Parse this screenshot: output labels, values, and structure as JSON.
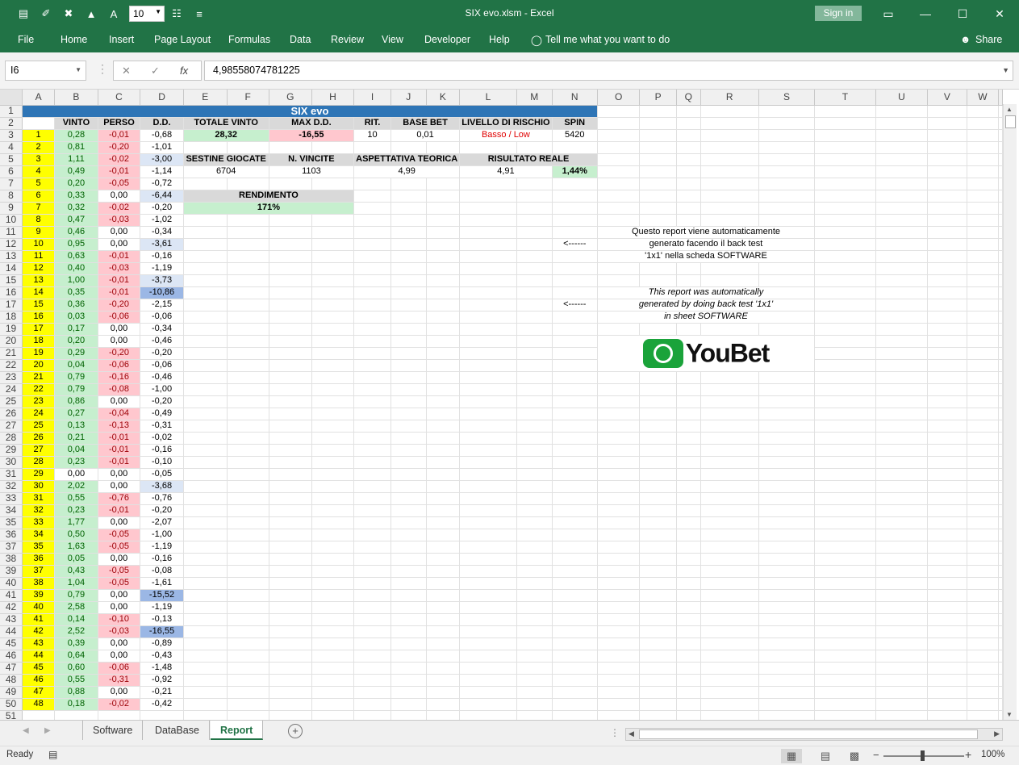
{
  "window": {
    "title": "SIX evo.xlsm  -  Excel",
    "sign_in": "Sign in",
    "font_size": "10"
  },
  "menu": {
    "items": [
      "File",
      "Home",
      "Insert",
      "Page Layout",
      "Formulas",
      "Data",
      "Review",
      "View",
      "Developer",
      "Help"
    ],
    "tell_me": "Tell me what you want to do",
    "share": "Share"
  },
  "formula_bar": {
    "name_box": "I6",
    "formula": "4,98558074781225"
  },
  "columns": [
    "A",
    "B",
    "C",
    "D",
    "E",
    "F",
    "G",
    "H",
    "I",
    "J",
    "K",
    "L",
    "M",
    "N",
    "O",
    "P",
    "Q",
    "R",
    "S",
    "T",
    "U",
    "V",
    "W"
  ],
  "report": {
    "banner": "SIX evo",
    "col_headers": [
      "VINTO",
      "PERSO",
      "D.D."
    ],
    "totale_vinto_label": "TOTALE VINTO",
    "totale_vinto": "28,32",
    "max_dd_label": "MAX D.D.",
    "max_dd": "-16,55",
    "rit_label": "RIT.",
    "rit": "10",
    "base_bet_label": "BASE BET",
    "base_bet": "0,01",
    "livello_label": "LIVELLO DI RISCHIO",
    "livello": "Basso / Low",
    "spin_label": "SPIN",
    "spin": "5420",
    "sestine_label": "SESTINE GIOCATE",
    "sestine": "6704",
    "vincite_label": "N. VINCITE",
    "vincite": "1103",
    "aspettativa_label": "ASPETTATIVA TEORICA",
    "aspettativa": "4,99",
    "risultato_label": "RISULTATO REALE",
    "risultato": "4,91",
    "risultato_pct": "1,44%",
    "rendimento_label": "RENDIMENTO",
    "rendimento": "171%",
    "note_it_arrow": "<------",
    "note_it": [
      "Questo report viene automaticamente",
      "generato facendo il back test",
      "'1x1' nella scheda SOFTWARE"
    ],
    "note_en_arrow": "<------",
    "note_en": [
      "This report was automatically",
      "generated by doing back test '1x1'",
      "in sheet SOFTWARE"
    ],
    "logo_text": "YouBet"
  },
  "rows": [
    [
      "1",
      "0,28",
      "-0,01",
      "-0,68"
    ],
    [
      "2",
      "0,81",
      "-0,20",
      "-1,01"
    ],
    [
      "3",
      "1,11",
      "-0,02",
      "-3,00"
    ],
    [
      "4",
      "0,49",
      "-0,01",
      "-1,14"
    ],
    [
      "5",
      "0,20",
      "-0,05",
      "-0,72"
    ],
    [
      "6",
      "0,33",
      "0,00",
      "-6,44"
    ],
    [
      "7",
      "0,32",
      "-0,02",
      "-0,20"
    ],
    [
      "8",
      "0,47",
      "-0,03",
      "-1,02"
    ],
    [
      "9",
      "0,46",
      "0,00",
      "-0,34"
    ],
    [
      "10",
      "0,95",
      "0,00",
      "-3,61"
    ],
    [
      "11",
      "0,63",
      "-0,01",
      "-0,16"
    ],
    [
      "12",
      "0,40",
      "-0,03",
      "-1,19"
    ],
    [
      "13",
      "1,00",
      "-0,01",
      "-3,73"
    ],
    [
      "14",
      "0,35",
      "-0,01",
      "-10,86"
    ],
    [
      "15",
      "0,36",
      "-0,20",
      "-2,15"
    ],
    [
      "16",
      "0,03",
      "-0,06",
      "-0,06"
    ],
    [
      "17",
      "0,17",
      "0,00",
      "-0,34"
    ],
    [
      "18",
      "0,20",
      "0,00",
      "-0,46"
    ],
    [
      "19",
      "0,29",
      "-0,20",
      "-0,20"
    ],
    [
      "20",
      "0,04",
      "-0,06",
      "-0,06"
    ],
    [
      "21",
      "0,79",
      "-0,16",
      "-0,46"
    ],
    [
      "22",
      "0,79",
      "-0,08",
      "-1,00"
    ],
    [
      "23",
      "0,86",
      "0,00",
      "-0,20"
    ],
    [
      "24",
      "0,27",
      "-0,04",
      "-0,49"
    ],
    [
      "25",
      "0,13",
      "-0,13",
      "-0,31"
    ],
    [
      "26",
      "0,21",
      "-0,01",
      "-0,02"
    ],
    [
      "27",
      "0,04",
      "-0,01",
      "-0,16"
    ],
    [
      "28",
      "0,23",
      "-0,01",
      "-0,10"
    ],
    [
      "29",
      "0,00",
      "0,00",
      "-0,05"
    ],
    [
      "30",
      "2,02",
      "0,00",
      "-3,68"
    ],
    [
      "31",
      "0,55",
      "-0,76",
      "-0,76"
    ],
    [
      "32",
      "0,23",
      "-0,01",
      "-0,20"
    ],
    [
      "33",
      "1,77",
      "0,00",
      "-2,07"
    ],
    [
      "34",
      "0,50",
      "-0,05",
      "-1,00"
    ],
    [
      "35",
      "1,63",
      "-0,05",
      "-1,19"
    ],
    [
      "36",
      "0,05",
      "0,00",
      "-0,16"
    ],
    [
      "37",
      "0,43",
      "-0,05",
      "-0,08"
    ],
    [
      "38",
      "1,04",
      "-0,05",
      "-1,61"
    ],
    [
      "39",
      "0,79",
      "0,00",
      "-15,52"
    ],
    [
      "40",
      "2,58",
      "0,00",
      "-1,19"
    ],
    [
      "41",
      "0,14",
      "-0,10",
      "-0,13"
    ],
    [
      "42",
      "2,52",
      "-0,03",
      "-16,55"
    ],
    [
      "43",
      "0,39",
      "0,00",
      "-0,89"
    ],
    [
      "44",
      "0,64",
      "0,00",
      "-0,43"
    ],
    [
      "45",
      "0,60",
      "-0,06",
      "-1,48"
    ],
    [
      "46",
      "0,55",
      "-0,31",
      "-0,92"
    ],
    [
      "47",
      "0,88",
      "0,00",
      "-0,21"
    ],
    [
      "48",
      "0,18",
      "-0,02",
      "-0,42"
    ]
  ],
  "sheets": [
    "Software",
    "DataBase",
    "Report"
  ],
  "status": {
    "ready": "Ready",
    "zoom": "100%"
  },
  "colors": {
    "excel_green": "#217346",
    "banner_blue": "#2e75b6",
    "win_green": "#c6efce",
    "loss_red": "#ffc7ce",
    "dd_blue": "#9bb7e5",
    "highlight_yellow": "#ffff00"
  }
}
